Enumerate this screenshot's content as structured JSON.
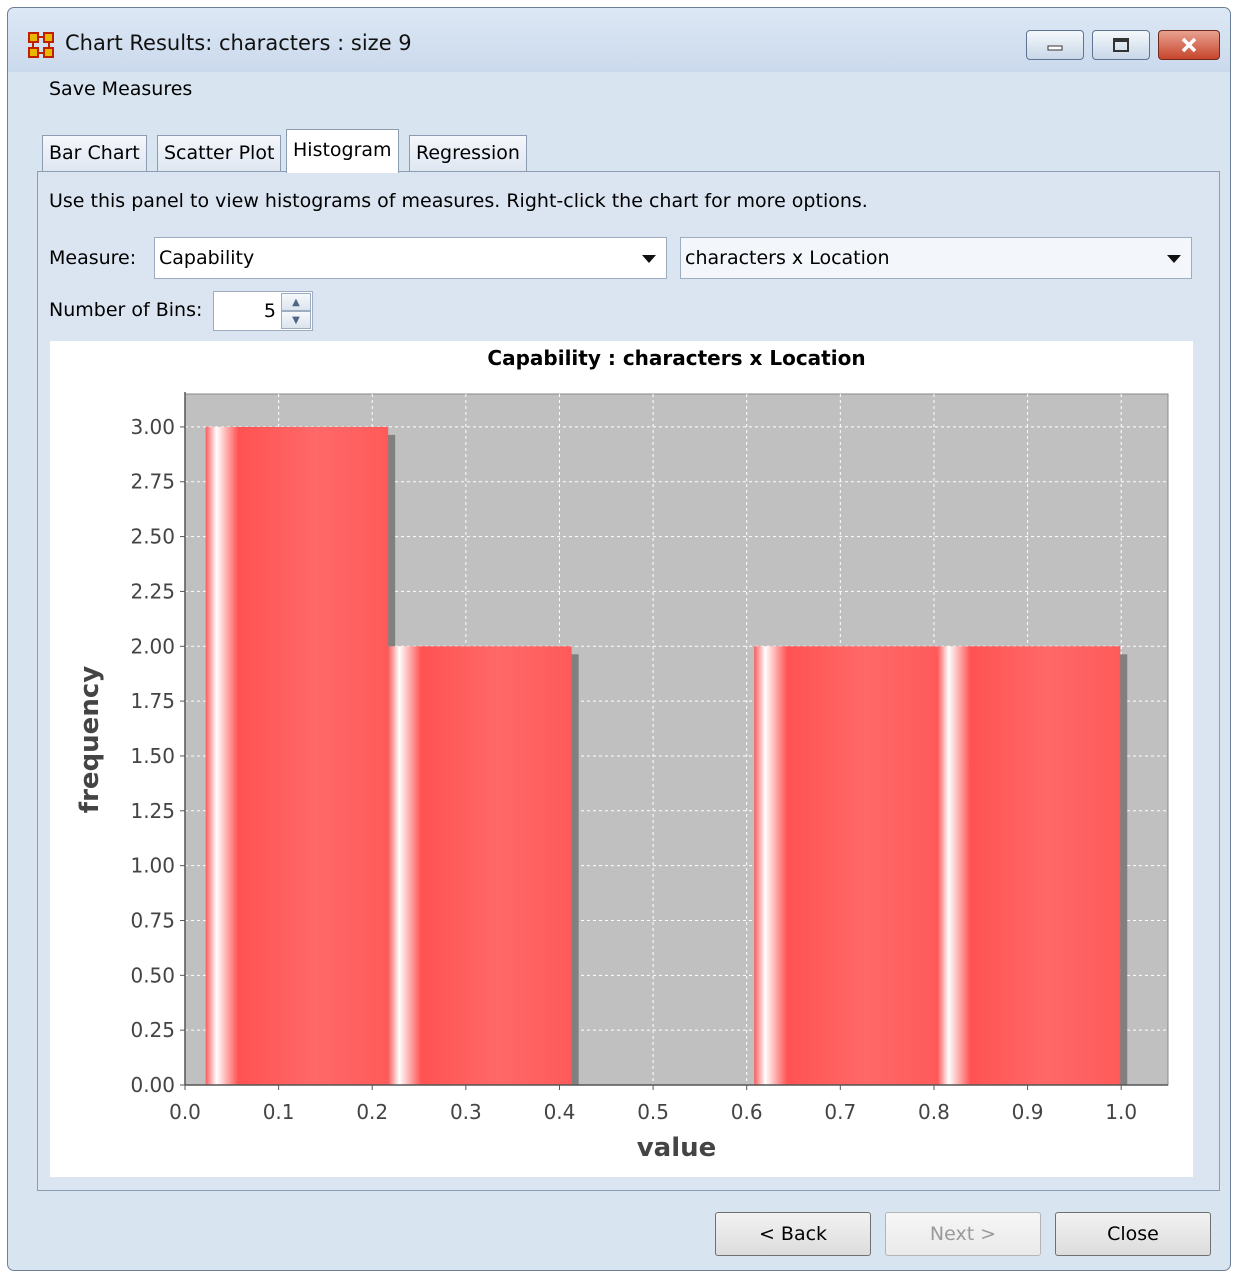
{
  "window": {
    "title": "Chart Results: characters : size 9"
  },
  "menu": {
    "save_measures": "Save Measures"
  },
  "tabs": [
    {
      "label": "Bar Chart",
      "active": false
    },
    {
      "label": "Scatter Plot",
      "active": false
    },
    {
      "label": "Histogram",
      "active": true
    },
    {
      "label": "Regression",
      "active": false
    }
  ],
  "panel": {
    "info_text": "Use this panel to view histograms of measures. Right-click the chart for more options.",
    "measure_label": "Measure:",
    "measure_value": "Capability",
    "network_value": "characters x Location",
    "bins_label": "Number of Bins:",
    "bins_value": "5"
  },
  "buttons": {
    "back": "< Back",
    "next": "Next >",
    "close": "Close"
  },
  "colors": {
    "bar": "#ff5a5a",
    "plot_bg": "#c0c0c0",
    "window_bg": "#d9e4f1"
  },
  "chart_data": {
    "type": "bar",
    "title": "Capability : characters x Location",
    "xlabel": "value",
    "ylabel": "frequency",
    "xlim": [
      0.0,
      1.05
    ],
    "ylim": [
      0.0,
      3.15
    ],
    "x_ticks": [
      "0.0",
      "0.1",
      "0.2",
      "0.3",
      "0.4",
      "0.5",
      "0.6",
      "0.7",
      "0.8",
      "0.9",
      "1.0"
    ],
    "y_ticks": [
      "0.00",
      "0.25",
      "0.50",
      "0.75",
      "1.00",
      "1.25",
      "1.50",
      "1.75",
      "2.00",
      "2.25",
      "2.50",
      "2.75",
      "3.00"
    ],
    "bins": [
      {
        "start": 0.022,
        "end": 0.217,
        "value": 3
      },
      {
        "start": 0.217,
        "end": 0.413,
        "value": 2
      },
      {
        "start": 0.413,
        "end": 0.608,
        "value": 0
      },
      {
        "start": 0.608,
        "end": 0.804,
        "value": 2
      },
      {
        "start": 0.804,
        "end": 0.999,
        "value": 2
      }
    ],
    "grid": true,
    "legend": "none"
  }
}
